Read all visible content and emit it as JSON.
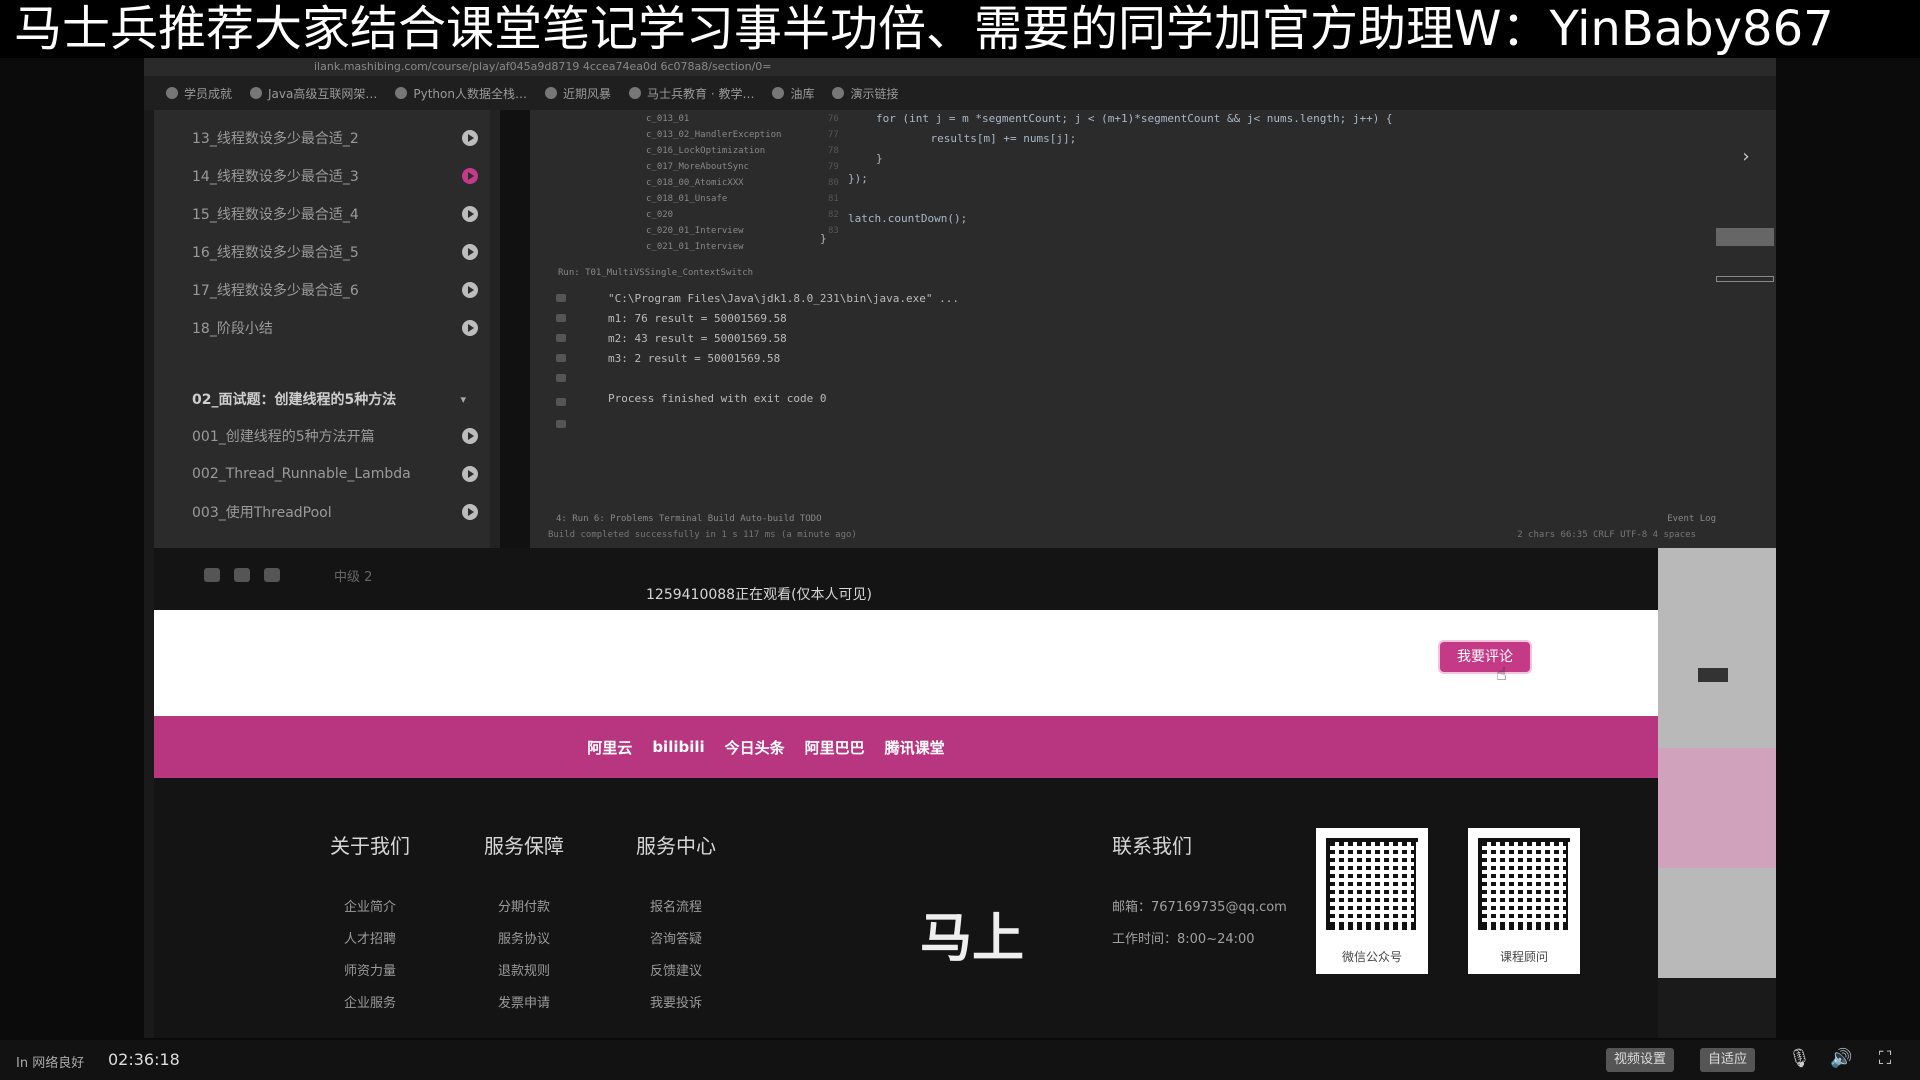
{
  "banner": {
    "text": "马士兵推荐大家结合课堂笔记学习事半功倍、需要的同学加官方助理W：YinBaby867"
  },
  "browser": {
    "address": "ilank.mashibing.com/course/play/af045a9d8719 4ccea74ea0d 6c078a8/section/0=",
    "bookmarks": [
      "学员成就",
      "Java高级互联网架…",
      "Python人数据全栈…",
      "近期风暴",
      "马士兵教育 · 教学…",
      "油库",
      "演示链接"
    ]
  },
  "playlist": {
    "items": [
      {
        "label": "13_线程数设多少最合适_2",
        "active": false
      },
      {
        "label": "14_线程数设多少最合适_3",
        "active": true
      },
      {
        "label": "15_线程数设多少最合适_4",
        "active": false
      },
      {
        "label": "16_线程数设多少最合适_5",
        "active": false
      },
      {
        "label": "17_线程数设多少最合适_6",
        "active": false
      },
      {
        "label": "18_阶段小结",
        "active": false
      }
    ],
    "section": "02_面试题：创建线程的5种方法",
    "section_items": [
      {
        "label": "001_创建线程的5种方法开篇"
      },
      {
        "label": "002_Thread_Runnable_Lambda"
      },
      {
        "label": "003_使用ThreadPool"
      }
    ]
  },
  "ide": {
    "tree": [
      "c_013_01",
      "c_013_02_HandlerException",
      "c_016_LockOptimization",
      "c_017_MoreAboutSync",
      "c_018_00_AtomicXXX",
      "c_018_01_Unsafe",
      "c_020",
      "c_020_01_Interview",
      "c_021_01_Interview"
    ],
    "line_numbers": [
      "76",
      "77",
      "78",
      "79",
      "80",
      "81",
      "82",
      "83"
    ],
    "code": [
      "for (int j = m *segmentCount; j < (m+1)*segmentCount && j< nums.length; j++) {",
      "    results[m] += nums[j];",
      "}",
      "});",
      "",
      "latch.countDown();",
      "}"
    ],
    "run_tab": "Run:   T01_MultiVSSingle_ContextSwitch",
    "console": [
      "\"C:\\Program Files\\Java\\jdk1.8.0_231\\bin\\java.exe\" ...",
      "m1: 76 result = 50001569.58",
      "m2: 43 result = 50001569.58",
      "m3: 2 result = 50001569.58",
      "",
      "Process finished with exit code 0"
    ],
    "status_tabs": "4: Run    6: Problems    Terminal    Build    Auto-build    TODO",
    "status_right": "Event Log",
    "build_msg": "Build completed successfully in 1 s 117 ms (a minute ago)",
    "status_info": "2 chars   66:35   CRLF   UTF-8   4 spaces"
  },
  "infobar": {
    "extra": "中级    2",
    "watching": "1259410088正在观看(仅本人可见)"
  },
  "comments": {
    "button": "我要评论"
  },
  "partners": [
    "阿里云",
    "bilibili",
    "今日头条",
    "阿里巴巴",
    "腾讯课堂"
  ],
  "footer": {
    "columns": [
      {
        "title": "关于我们",
        "links": [
          "企业简介",
          "人才招聘",
          "师资力量",
          "企业服务"
        ]
      },
      {
        "title": "服务保障",
        "links": [
          "分期付款",
          "服务协议",
          "退款规则",
          "发票申请"
        ]
      },
      {
        "title": "服务中心",
        "links": [
          "报名流程",
          "咨询答疑",
          "反馈建议",
          "我要投诉"
        ]
      }
    ],
    "brand": "马上",
    "contact_title": "联系我们",
    "email": "邮箱：767169735@qq.com",
    "hours": "工作时间：8:00~24:00",
    "qr": [
      {
        "caption": "微信公众号"
      },
      {
        "caption": "课程顾问"
      }
    ]
  },
  "controls": {
    "status": "In 网络良好",
    "time": "02:36:18",
    "btn1": "视频设置",
    "btn2": "自适应"
  },
  "colors": {
    "accent": "#c43a86",
    "partner_bar": "#b83580"
  }
}
